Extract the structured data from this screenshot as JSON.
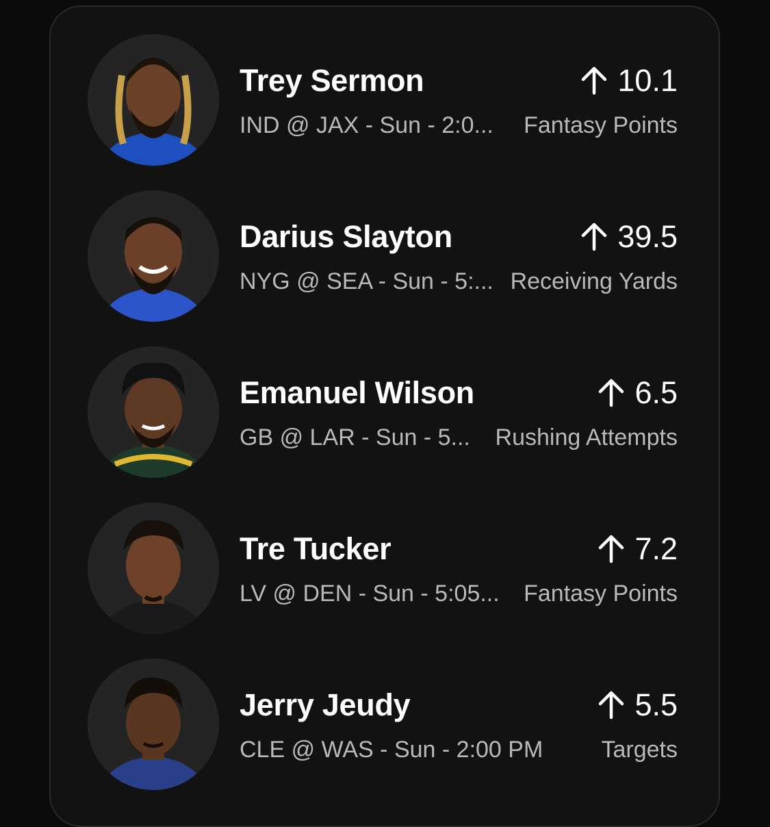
{
  "colors": {
    "background": "#0b0b0b",
    "card": "#121212",
    "card_border": "#2a2a2a",
    "name": "#ffffff",
    "subtext": "#b9b9b9"
  },
  "picks": [
    {
      "name": "Trey Sermon",
      "game": "IND  @ JAX - Sun - 2:0...",
      "direction": "up-arrow-icon",
      "value": "10.1",
      "stat": "Fantasy Points",
      "jersey_color": "#1e4fbf",
      "skin": "#6b4128"
    },
    {
      "name": "Darius Slayton",
      "game": "NYG  @ SEA - Sun - 5:...",
      "direction": "up-arrow-icon",
      "value": "39.5",
      "stat": "Receiving Yards",
      "jersey_color": "#2b55c8",
      "skin": "#6a4128"
    },
    {
      "name": "Emanuel Wilson",
      "game": "GB  @ LAR - Sun - 5...",
      "direction": "up-arrow-icon",
      "value": "6.5",
      "stat": "Rushing Attempts",
      "jersey_color": "#1d3a2a",
      "skin": "#5e3a24"
    },
    {
      "name": "Tre Tucker",
      "game": "LV  @ DEN - Sun - 5:05...",
      "direction": "up-arrow-icon",
      "value": "7.2",
      "stat": "Fantasy Points",
      "jersey_color": "#1a1a1a",
      "skin": "#6d4229"
    },
    {
      "name": "Jerry Jeudy",
      "game": "CLE  @ WAS - Sun - 2:00 PM",
      "direction": "up-arrow-icon",
      "value": "5.5",
      "stat": "Targets",
      "jersey_color": "#2a3f8a",
      "skin": "#5a3621"
    }
  ]
}
